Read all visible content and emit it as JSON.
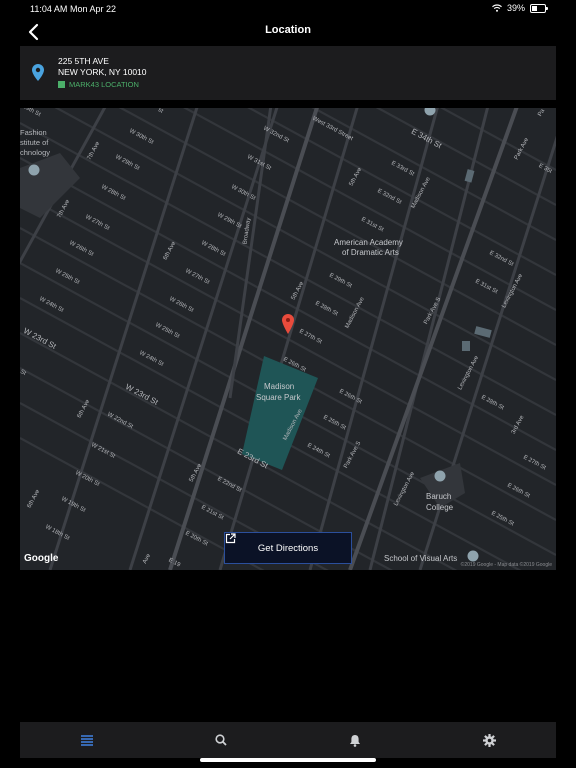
{
  "status_bar": {
    "time": "11:04 AM",
    "date": "Mon Apr 22",
    "battery": "39%",
    "battery_level": 0.39
  },
  "nav": {
    "title": "Location",
    "back_icon": "chevron-left-icon"
  },
  "location": {
    "address_line1": "225 5TH AVE",
    "address_line2": "NEW YORK, NY 10010",
    "tag_label": "MARK43 LOCATION",
    "pin_color": "#4aa3df",
    "tag_color": "#4caf6a"
  },
  "map": {
    "labels": {
      "fashion": "Fashion",
      "fashion2": "stitute of",
      "fashion3": "chnology",
      "aada1": "American Academy",
      "aada2": "of Dramatic Arts",
      "msp1": "Madison",
      "msp2": "Square Park",
      "baruch1": "Baruch",
      "baruch2": "College",
      "sva": "School of Visual Arts",
      "w29th": "29th St",
      "w30th": "W 30th St",
      "w29th_b": "W 29th St",
      "w28th": "W 28th St",
      "w27th": "W 27th St",
      "w26th": "W 26th St",
      "w25th": "W 25th St",
      "w24th": "W 24th St",
      "w23rd": "W 23rd St",
      "w23rd_b": "W 23rd St",
      "w22nd": "W 22nd St",
      "w21st": "W 21st St",
      "w20th": "W 20th St",
      "w19th": "W 19th St",
      "w18th": "W 18th St",
      "w32nd": "W 32nd St",
      "w31st": "W 31st St",
      "w30th_b": "W 30th St",
      "w29th_c": "W 29th St",
      "w28th_b": "W 28th St",
      "w27th_b": "W 27th St",
      "w26th_b": "W 26th St",
      "w25th_b": "W 25th St",
      "w24th_b": "W 24th St",
      "w33rd": "West 33rd Street",
      "e34th": "E 34th St",
      "e33rd": "E 33rd St",
      "e32nd": "E 32nd St",
      "e31st": "E 31st St",
      "e29th": "E 29th St",
      "e28th": "E 28th St",
      "e27th": "E 27th St",
      "e26th": "E 26th St",
      "e25th": "E 25th St",
      "e24th": "E 24th St",
      "e23rd": "E 23rd St",
      "e22nd": "E 22nd St",
      "e21st": "E 21st St",
      "e20th": "E 20th St",
      "e32nd_b": "E 32nd St",
      "e31st_b": "E 31st St",
      "e28th_b": "E 28th St",
      "e27th_b": "E 27th St",
      "e26th_b": "E 26th St",
      "e25th_b": "E 25th St",
      "e35th": "E 35t",
      "seventh": "7th Ave",
      "seventh_b": "7th Ave",
      "sixth": "6th Ave",
      "sixth_b": "6th Ave",
      "sixth_c": "6th Ave",
      "fifth": "5th Ave",
      "fifth_b": "5th Ave",
      "fifth_c": "5th Ave",
      "broadway": "Broadway",
      "madison": "Madison Ave",
      "madison_b": "Madison Ave",
      "madison_c": "Madison Ave",
      "park": "Park Ave",
      "park_s": "Park Ave S",
      "park_s_b": "Park Ave S",
      "lex": "Lexington Ave",
      "lex_b": "Lexington Ave",
      "lex_c": "Lexington Ave",
      "third": "3rd Ave",
      "ave_cut": "Ave",
      "e19": "E 19",
      "st_cut": "st",
      "st_cut2": "St",
      "st_cut3": "Pa"
    },
    "google": "Google",
    "attribution": "©2019 Google - Map data ©2019 Google",
    "directions_label": "Get Directions"
  },
  "tabs": [
    {
      "icon": "list-icon",
      "active": true
    },
    {
      "icon": "search-icon",
      "active": false
    },
    {
      "icon": "bell-icon",
      "active": false
    },
    {
      "icon": "gear-icon",
      "active": false
    }
  ],
  "colors": {
    "accent": "#3e7bd6",
    "park": "#1f5556",
    "marker": "#e94b3c"
  }
}
